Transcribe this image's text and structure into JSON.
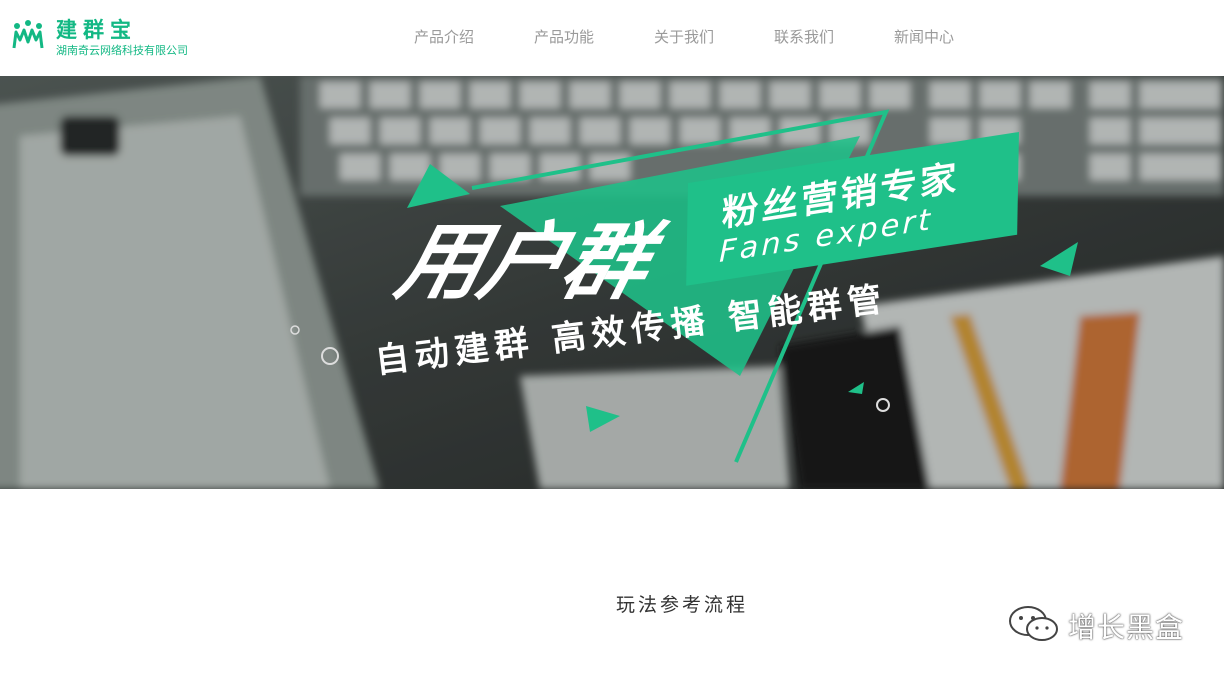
{
  "header": {
    "logo_name": "建群宝",
    "company": "湖南奇云网络科技有限公司",
    "nav": [
      {
        "label": "产品介绍"
      },
      {
        "label": "产品功能"
      },
      {
        "label": "关于我们"
      },
      {
        "label": "联系我们"
      },
      {
        "label": "新闻中心"
      }
    ]
  },
  "banner": {
    "title": "用户群",
    "tag_cn": "粉丝营销专家",
    "tag_en": "Fans expert",
    "subtitle": "自动建群 高效传播 智能群管"
  },
  "section": {
    "title": "玩法参考流程"
  },
  "watermark": {
    "text": "增长黑盒"
  },
  "colors": {
    "brand": "#13b884",
    "accent": "#1fc089",
    "nav_text": "#9a9a9a"
  }
}
